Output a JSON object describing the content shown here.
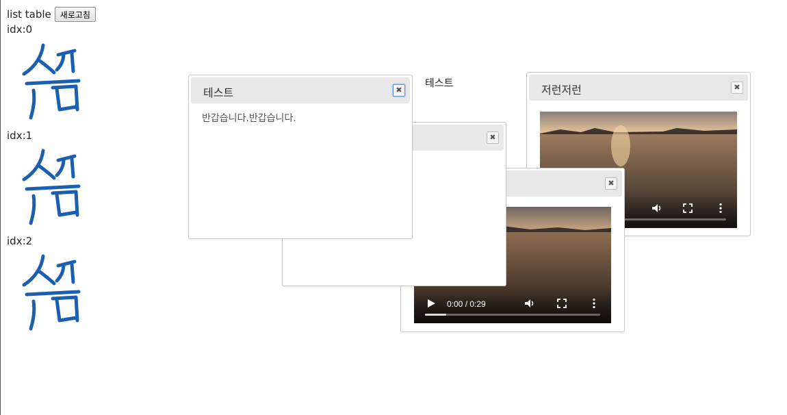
{
  "header": {
    "title": "list table",
    "refresh_label": "새로고침"
  },
  "list": [
    {
      "label": "idx:0"
    },
    {
      "label": "idx:1"
    },
    {
      "label": "idx:2"
    }
  ],
  "floating_label": "테스트",
  "dialogs": {
    "d1": {
      "title": "테스트",
      "body": "반갑습니다.반갑습니다.",
      "close": "✖"
    },
    "d2": {
      "title": "",
      "close": "✖"
    },
    "d3": {
      "title": "",
      "close": "✖",
      "time": "0:00 / 0:29",
      "progress": 0.12
    },
    "d4": {
      "title": "저런저런",
      "close": "✖",
      "progress": 0.0
    }
  }
}
